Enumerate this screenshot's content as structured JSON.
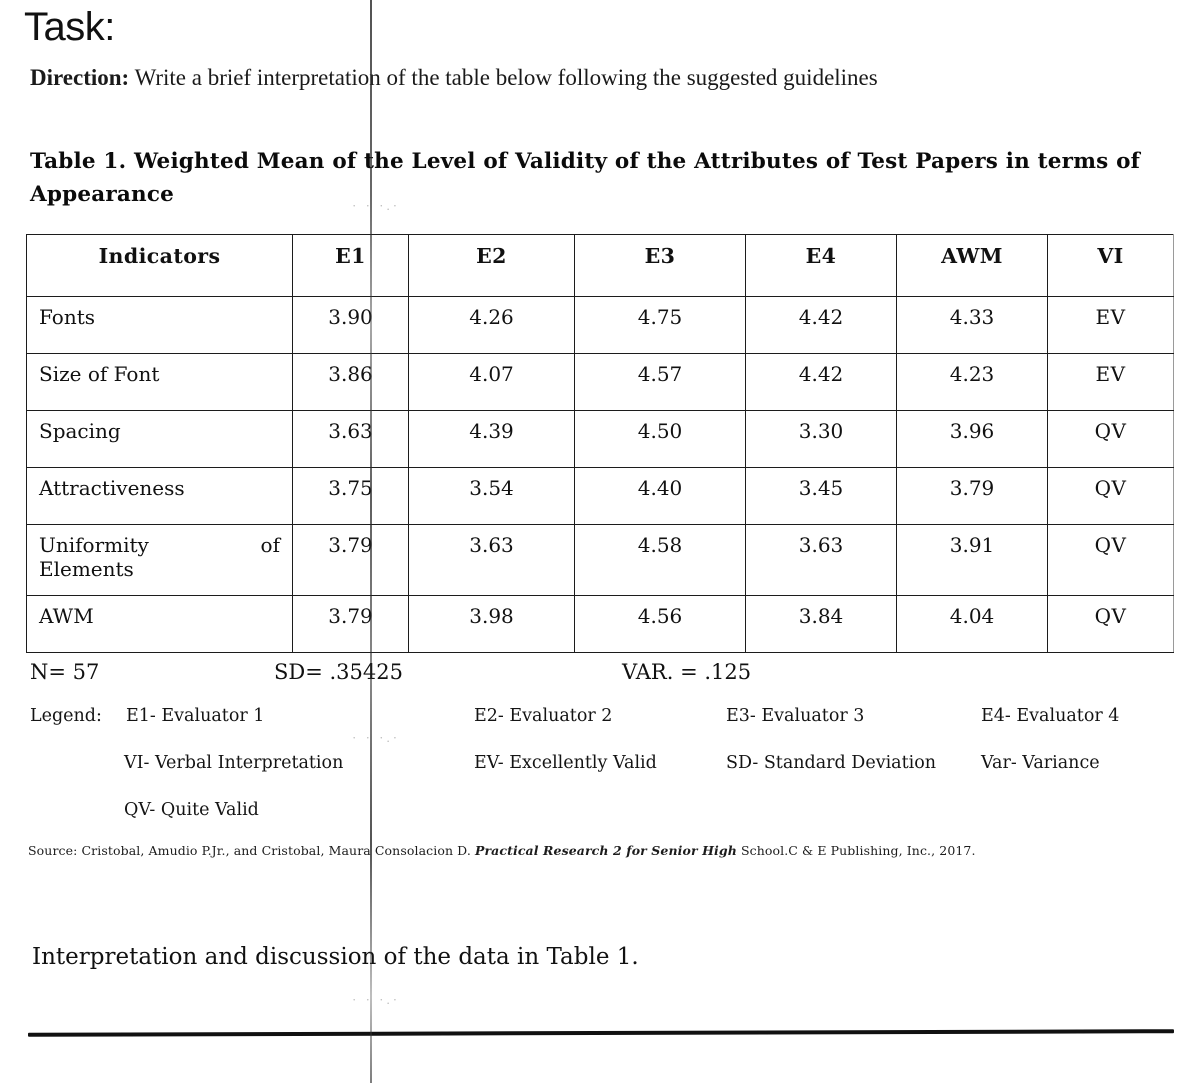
{
  "heading": {
    "task_label": "Task:",
    "direction_label": "Direction:",
    "direction_text": "Write a brief interpretation of the table below following the suggested guidelines"
  },
  "table_caption": "Table 1. Weighted Mean of the Level of Validity of the Attributes of Test Papers in terms of Appearance",
  "table": {
    "columns": [
      "Indicators",
      "E1",
      "E2",
      "E3",
      "E4",
      "AWM",
      "VI"
    ],
    "rows": [
      {
        "indicator": "Fonts",
        "indicator_suffix": "",
        "e1": "3.90",
        "e2": "4.26",
        "e3": "4.75",
        "e4": "4.42",
        "awm": "4.33",
        "vi": "EV"
      },
      {
        "indicator": "Size of Font",
        "indicator_suffix": "",
        "e1": "3.86",
        "e2": "4.07",
        "e3": "4.57",
        "e4": "4.42",
        "awm": "4.23",
        "vi": "EV"
      },
      {
        "indicator": "Spacing",
        "indicator_suffix": "",
        "e1": "3.63",
        "e2": "4.39",
        "e3": "4.50",
        "e4": "3.30",
        "awm": "3.96",
        "vi": "QV"
      },
      {
        "indicator": "Attractiveness",
        "indicator_suffix": "",
        "e1": "3.75",
        "e2": "3.54",
        "e3": "4.40",
        "e4": "3.45",
        "awm": "3.79",
        "vi": "QV"
      },
      {
        "indicator": "Uniformity",
        "indicator_suffix": "of",
        "indicator_line2": "Elements",
        "e1": "3.79",
        "e2": "3.63",
        "e3": "4.58",
        "e4": "3.63",
        "awm": "3.91",
        "vi": "QV"
      },
      {
        "indicator": "AWM",
        "indicator_suffix": "",
        "e1": "3.79",
        "e2": "3.98",
        "e3": "4.56",
        "e4": "3.84",
        "awm": "4.04",
        "vi": "QV"
      }
    ]
  },
  "stats": {
    "n": "N= 57",
    "sd": "SD= .35425",
    "var": "VAR. = .125"
  },
  "legend": {
    "label": "Legend:",
    "row1": {
      "c1": "E1- Evaluator 1",
      "c2": "E2- Evaluator 2",
      "c3": "E3- Evaluator 3",
      "c4": "E4- Evaluator 4"
    },
    "row2": {
      "c1": "VI- Verbal Interpretation",
      "c2": "EV- Excellently Valid",
      "c3": "SD- Standard Deviation",
      "c4": "Var- Variance"
    },
    "row3": {
      "c1": "QV- Quite Valid"
    }
  },
  "source": {
    "prefix": "Source: Cristobal, Amudio P.Jr., and Cristobal, Maura Consolacion D. ",
    "title": "Practical Research 2 for Senior High",
    "suffix": " School.C & E Publishing, Inc., 2017."
  },
  "closing": "Interpretation and discussion of the data in Table 1."
}
